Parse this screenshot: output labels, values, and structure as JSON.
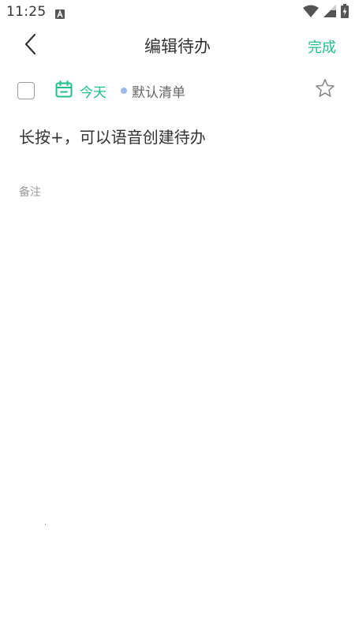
{
  "status_bar": {
    "time": "11:25",
    "icons": [
      "keyboard-a-icon",
      "wifi-icon",
      "cell-signal-icon",
      "battery-charging-icon"
    ]
  },
  "header": {
    "title": "编辑待办",
    "done_label": "完成",
    "back_icon": "back-arrow-icon"
  },
  "task": {
    "due_label": "今天",
    "list_name": "默认清单",
    "title": "长按+，可以语音创建待办",
    "notes_placeholder": "备注",
    "completed": false,
    "starred": false
  },
  "colors": {
    "accent": "#1fbf8a",
    "list_dot": "#9bbaf0",
    "text_primary": "#333333",
    "text_secondary": "#666666",
    "text_hint": "#9a9a9a"
  }
}
